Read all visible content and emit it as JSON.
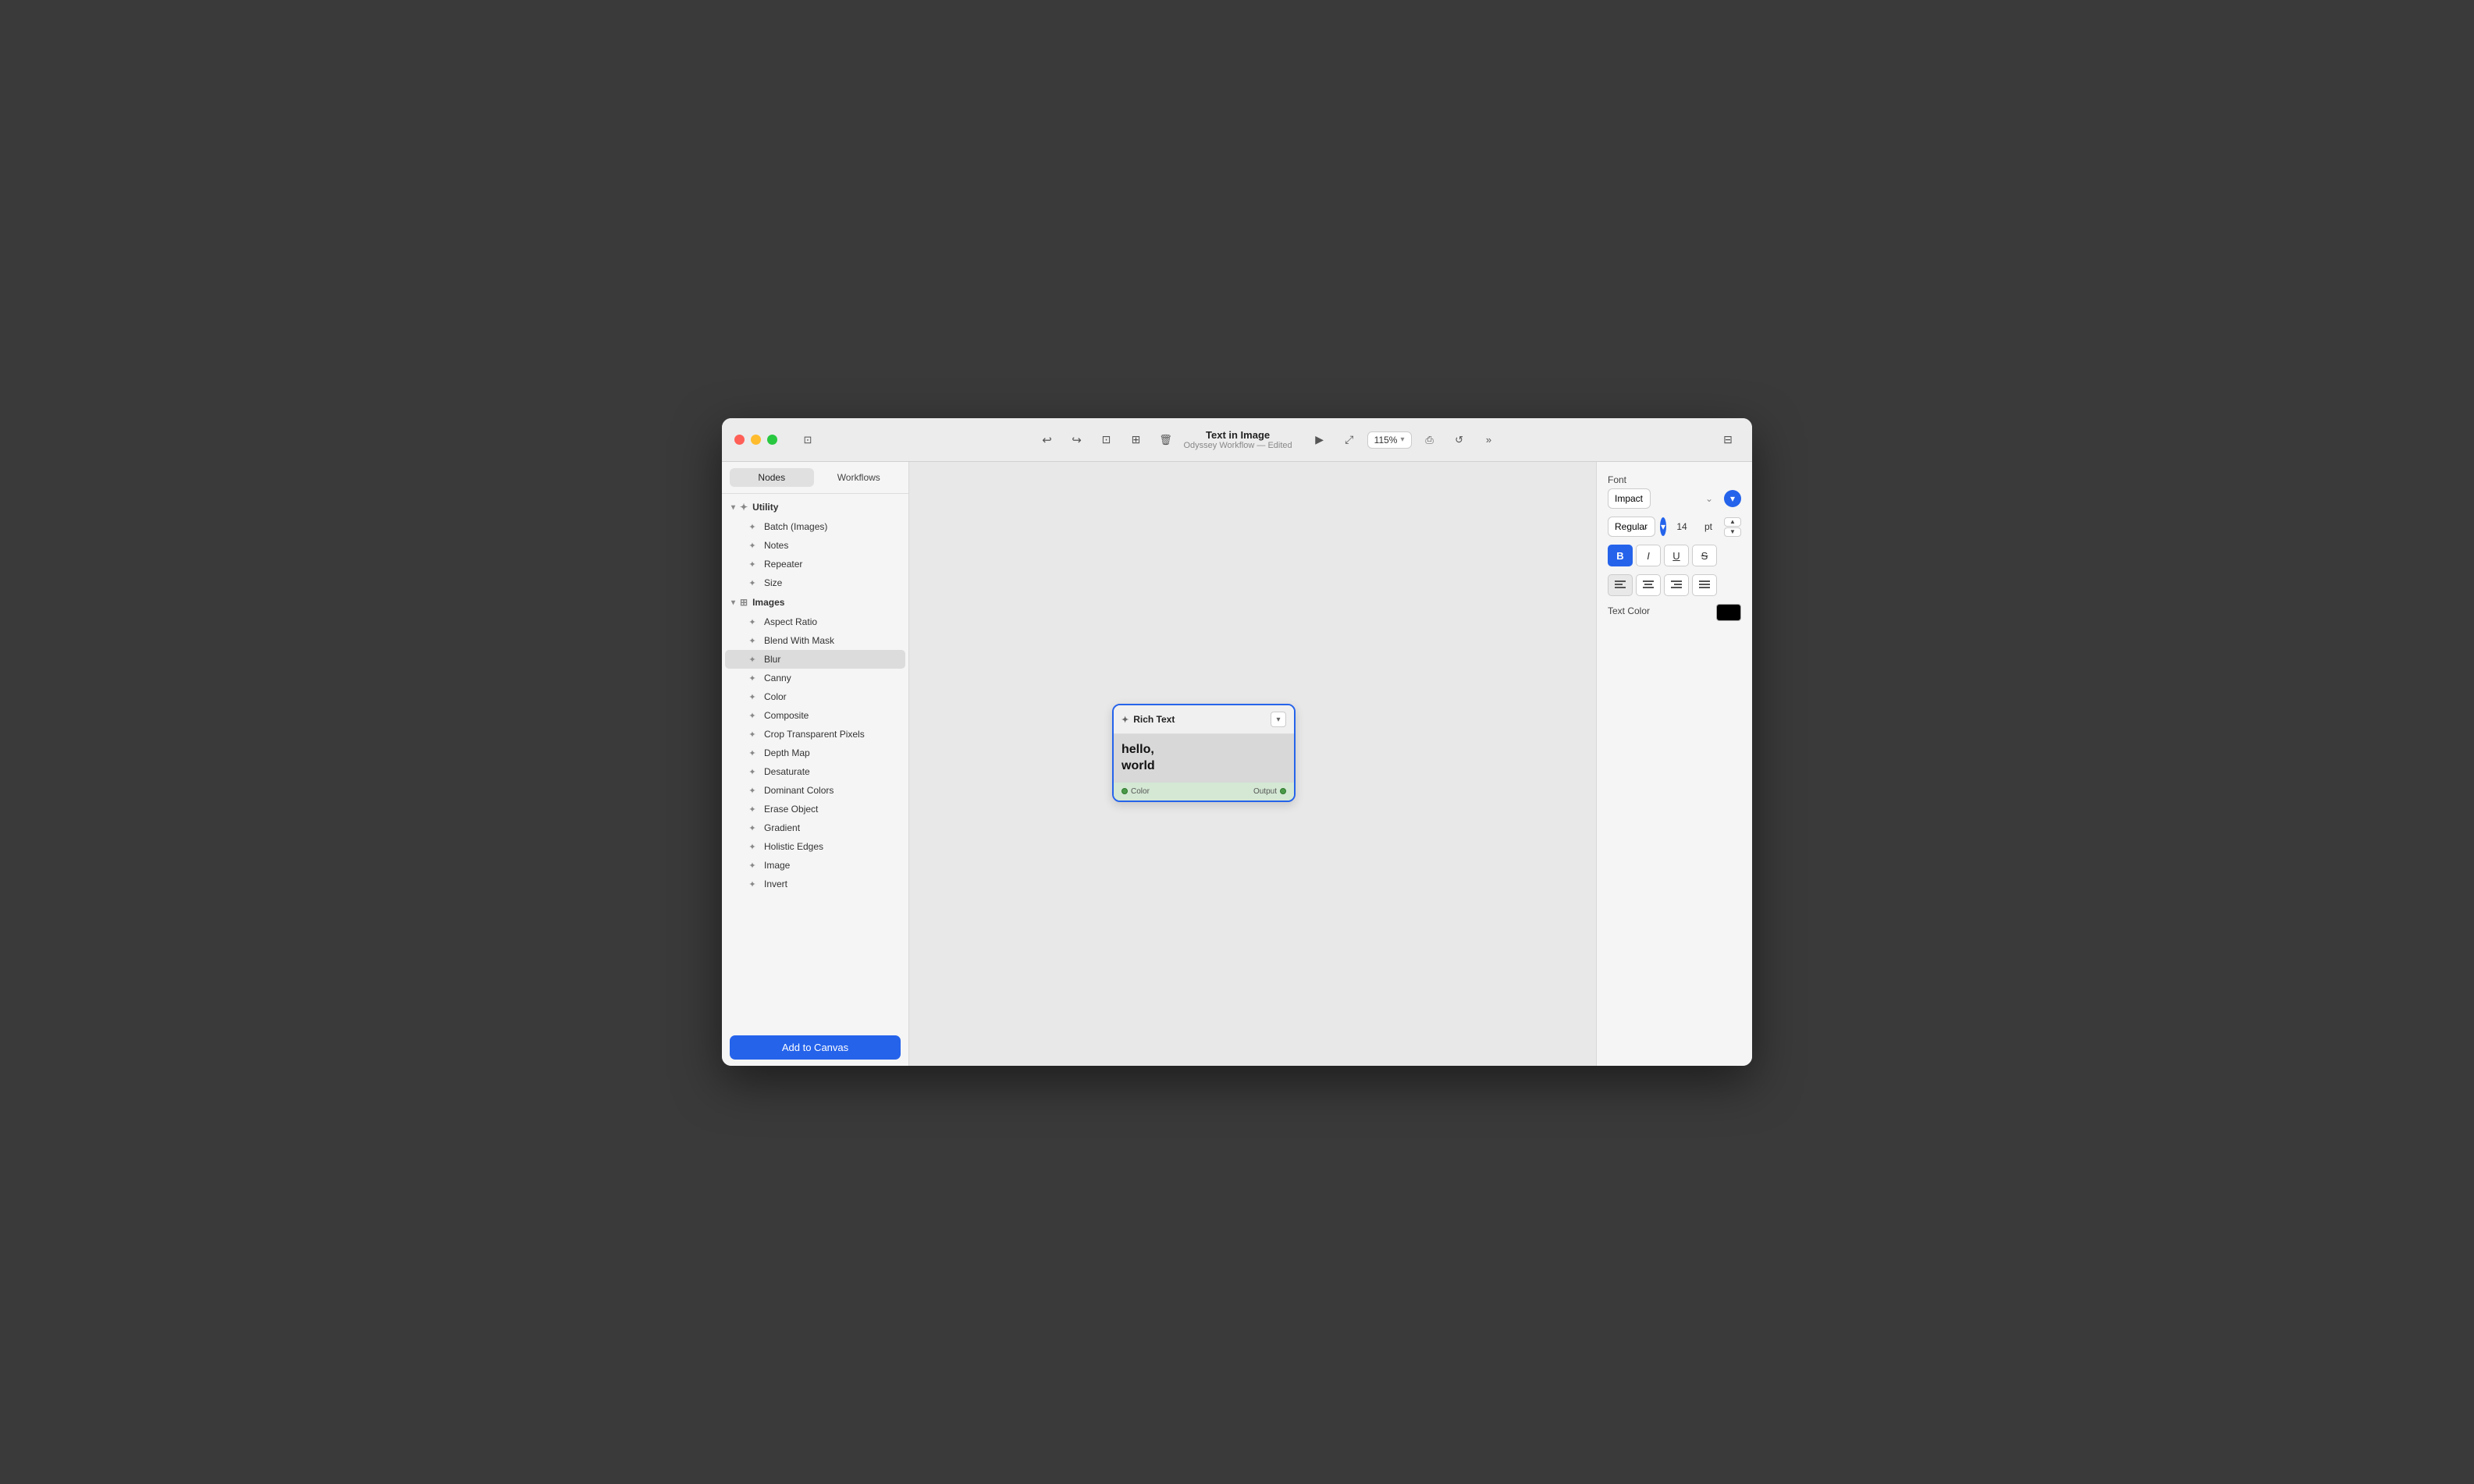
{
  "window": {
    "title": "Text in Image",
    "subtitle": "Odyssey Workflow — Edited"
  },
  "toolbar": {
    "zoom_label": "115%",
    "undo_icon": "↩",
    "redo_icon": "↪",
    "copy_icon": "⊡",
    "paste_icon": "⊞",
    "delete_icon": "🗑",
    "play_icon": "▶",
    "resize_icon": "⤢",
    "share_icon": "⎙",
    "refresh_icon": "↺",
    "more_icon": "»",
    "panel_icon": "⊞"
  },
  "sidebar": {
    "tab_nodes": "Nodes",
    "tab_workflows": "Workflows",
    "sections": [
      {
        "id": "utility",
        "label": "Utility",
        "expanded": true,
        "items": [
          {
            "label": "Batch (Images)",
            "icon": "✦"
          },
          {
            "label": "Notes",
            "icon": "✦"
          },
          {
            "label": "Repeater",
            "icon": "✦"
          },
          {
            "label": "Size",
            "icon": "✦"
          }
        ]
      },
      {
        "id": "images",
        "label": "Images",
        "expanded": true,
        "items": [
          {
            "label": "Aspect Ratio",
            "icon": "✦",
            "active": false
          },
          {
            "label": "Blend With Mask",
            "icon": "✦",
            "active": false
          },
          {
            "label": "Blur",
            "icon": "✦",
            "active": true
          },
          {
            "label": "Canny",
            "icon": "✦",
            "active": false
          },
          {
            "label": "Color",
            "icon": "✦",
            "active": false
          },
          {
            "label": "Composite",
            "icon": "✦",
            "active": false
          },
          {
            "label": "Crop Transparent Pixels",
            "icon": "✦",
            "active": false
          },
          {
            "label": "Depth Map",
            "icon": "✦",
            "active": false
          },
          {
            "label": "Desaturate",
            "icon": "✦",
            "active": false
          },
          {
            "label": "Dominant Colors",
            "icon": "✦",
            "active": false
          },
          {
            "label": "Erase Object",
            "icon": "✦",
            "active": false
          },
          {
            "label": "Gradient",
            "icon": "✦",
            "active": false
          },
          {
            "label": "Holistic Edges",
            "icon": "✦",
            "active": false
          },
          {
            "label": "Image",
            "icon": "✦",
            "active": false
          },
          {
            "label": "Invert",
            "icon": "✦",
            "active": false
          }
        ]
      }
    ],
    "add_button": "Add to Canvas"
  },
  "node": {
    "title": "Rich Text",
    "icon": "✦",
    "body_lines": [
      "hello,",
      "world"
    ],
    "footer_left": "Color",
    "footer_right": "Output"
  },
  "right_panel": {
    "font_label": "Font",
    "font_value": "Impact",
    "weight_value": "Regular",
    "size_value": "14",
    "size_unit": "pt",
    "bold_label": "B",
    "italic_label": "I",
    "underline_label": "U",
    "strikethrough_label": "S",
    "align_left": "≡",
    "align_center": "≡",
    "align_right": "≡",
    "align_justify": "≡",
    "text_color_label": "Text Color",
    "text_color": "#000000"
  }
}
